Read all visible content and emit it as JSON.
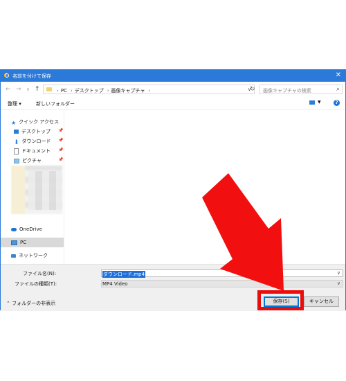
{
  "dialog": {
    "title": "名前を付けて保存",
    "close_glyph": "✕"
  },
  "nav": {
    "back": "←",
    "forward": "→",
    "recent": "∨",
    "up": "↑",
    "breadcrumbs": [
      "PC",
      "デスクトップ",
      "画像キャプチャ"
    ],
    "breadcrumb_sep": "›",
    "search_placeholder": "画像キャプチャの検索"
  },
  "toolbar": {
    "organize": "整理 ▾",
    "new_folder": "新しいフォルダー"
  },
  "sidebar": {
    "quick_access": "クイック アクセス",
    "items": [
      {
        "label": "デスクトップ",
        "icon": "desktop-icon",
        "pinned": true
      },
      {
        "label": "ダウンロード",
        "icon": "download-icon",
        "pinned": true
      },
      {
        "label": "ドキュメント",
        "icon": "document-icon",
        "pinned": true
      },
      {
        "label": "ピクチャ",
        "icon": "pictures-icon",
        "pinned": true
      }
    ],
    "onedrive": "OneDrive",
    "pc": "PC",
    "network": "ネットワーク"
  },
  "form": {
    "filename_label": "ファイル名(N):",
    "filename_value": "ダウンロード.mp4",
    "filetype_label": "ファイルの種類(T):",
    "filetype_value": "MP4 Video",
    "hide_folders": "フォルダーの非表示"
  },
  "buttons": {
    "save": "保存(S)",
    "cancel": "キャンセル"
  },
  "colors": {
    "title_bar": "#2b79d8",
    "highlight": "#ea0d0d",
    "arrow": "#f20f0f"
  }
}
